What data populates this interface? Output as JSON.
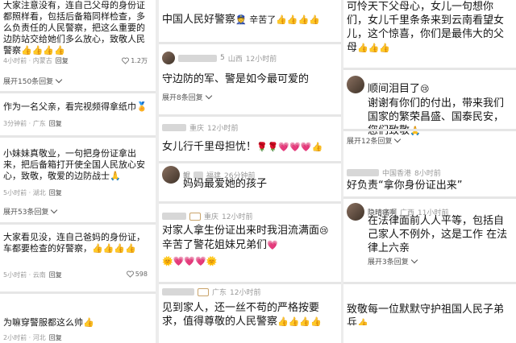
{
  "col1": {
    "comments": [
      {
        "text": "大家注意没有，连自己父母的身份证都照样看，包括后备箱同样检查，多么负责任的人民警察，把这么重要的边防站交给她们多么放心，致敬人民警察",
        "emoji": "👍👍👍👍",
        "time": "4小时前 · 内蒙古",
        "reply": "回复",
        "likes": "1.2万"
      },
      {
        "text": "作为一名父亲，看完视频得拿纸巾",
        "emoji": "🏅",
        "time": "3分钟前 · 广东",
        "reply": "回复"
      },
      {
        "text": "小妹妹真敬业，一句把身份证拿出来，把后备箱打开使全国人民放心安心，致敬，敬爱的边防战士",
        "emoji": "🙏",
        "time": "5小时前 · 湖北",
        "reply": "回复"
      },
      {
        "text": "大家看见没，连自己爸妈的身份证，车都要检查的好警察，",
        "emoji": "👍👍👍👍",
        "time": "5小时前 · 云南",
        "reply": "回复",
        "likes": "598"
      },
      {
        "text": "为嘛穿警服都这么帅",
        "emoji": "👍",
        "time": "2小时前 · 河北",
        "reply": "回复"
      }
    ],
    "expand1": "展开150条回复",
    "expand2": "展开53条回复"
  },
  "col2": {
    "comments": [
      {
        "text": "中国人民好警察",
        "emoji": "👮 辛苦了👍👍👍👍",
        "top": true
      },
      {
        "username_suffix": "5",
        "location": "山西",
        "time": "12小时前",
        "text": "守边防的军、警是如今最可爱的",
        "emoji": ""
      },
      {
        "location": "重庆",
        "time": "12小时前",
        "text": "女儿行千里母担忧！",
        "emoji": "🌹🌹💗💗💗👍"
      },
      {
        "username": "鲲",
        "location": "福建",
        "time": "26分钟前",
        "text": "妈妈最爱她的孩子",
        "emoji": ""
      },
      {
        "location": "重庆",
        "time": "12小时前",
        "text": "对家人拿生份证出来时我泪流满面",
        "emoji": "😢",
        "text2": "辛苦了警花姐妹兄弟们",
        "emoji2": "💗",
        "emoji3": "🌞💗💗💗🌞"
      },
      {
        "location": "广东",
        "time": "12小时前",
        "text": "见到家人，还一丝不苟的严格按要求，值得尊敬的人民警察",
        "emoji": "👍👍👍👍"
      }
    ],
    "expand": "展开8条回复"
  },
  "col3": {
    "comments": [
      {
        "text": "可怜天下父母心，女儿一句想你们，女儿千里条条来到云南看望女儿，这个惊喜，你们是最伟大的父母",
        "emoji": "👍👍👍"
      },
      {
        "text": "顺间泪目了",
        "emoji": "😢",
        "text2": "谢谢有你们的付出，带来我们国家的繁荣昌盛、国泰民安，您们致敬",
        "emoji2": "🙏"
      },
      {
        "location": "中国香港",
        "time": "8小时前",
        "text": "好负责“拿你身份证出来”",
        "emoji": ""
      },
      {
        "username": "隐晴痛啊",
        "location": "广西",
        "time": "11小时前",
        "text": "在法律面前人人平等，包括自己家人不例外，这是工作 在法律上六亲",
        "emoji": ""
      },
      {
        "text": "致敬每一位默默守护祖国人民子弟兵",
        "emoji": "👍"
      }
    ],
    "expand1": "展开12条回复",
    "expand2": "展开3条回复"
  }
}
